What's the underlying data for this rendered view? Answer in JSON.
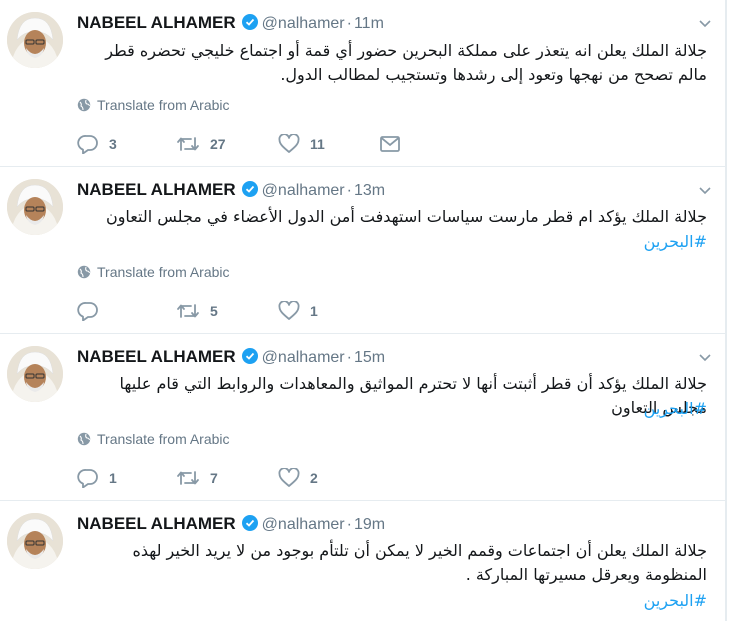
{
  "tweets": [
    {
      "name": "NABEEL ALHAMER",
      "handle": "@nalhamer",
      "time": "11m",
      "text": "جلالة الملك يعلن انه يتعذر على مملكة البحرين حضور أي قمة أو اجتماع خليجي تحضره قطر مالم تصحح من نهجها وتعود إلى رشدها وتستجيب لمطالب الدول.",
      "hashtag": "",
      "translate": "Translate from Arabic",
      "replies": "3",
      "retweets": "27",
      "likes": "11"
    },
    {
      "name": "NABEEL ALHAMER",
      "handle": "@nalhamer",
      "time": "13m",
      "text": "جلالة الملك يؤكد ام قطر مارست سياسات استهدفت أمن الدول الأعضاء في مجلس التعاون",
      "hashtag": "#البحرين",
      "translate": "Translate from Arabic",
      "replies": "",
      "retweets": "5",
      "likes": "1"
    },
    {
      "name": "NABEEL ALHAMER",
      "handle": "@nalhamer",
      "time": "15m",
      "text": "جلالة الملك يؤكد أن قطر أثبتت أنها لا تحترم المواثيق والمعاهدات والروابط التي قام عليها مجلس التعاون",
      "hashtag": "#البحرين",
      "translate": "Translate from Arabic",
      "replies": "1",
      "retweets": "7",
      "likes": "2"
    },
    {
      "name": "NABEEL ALHAMER",
      "handle": "@nalhamer",
      "time": "19m",
      "text": "جلالة الملك يعلن أن اجتماعات وقمم الخير لا يمكن أن تلتأم بوجود من لا يريد الخير لهذه المنظومة ويعرقل مسيرتها المباركة .",
      "hashtag": "#البحرين"
    }
  ],
  "colors": {
    "accent": "#1da1f2",
    "secondary_text": "#657786",
    "divider": "#e6ecf0"
  },
  "icons": {
    "verified": "verified-badge-icon",
    "caret": "chevron-down-icon",
    "globe": "globe-icon",
    "reply": "reply-icon",
    "retweet": "retweet-icon",
    "like": "heart-icon",
    "dm": "envelope-icon"
  }
}
